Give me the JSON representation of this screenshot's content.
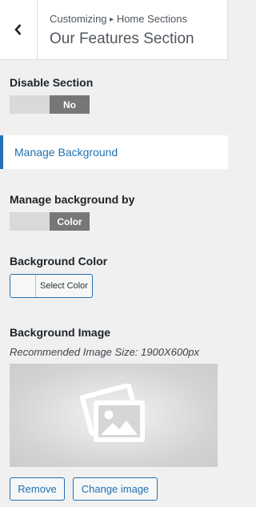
{
  "header": {
    "breadcrumb_root": "Customizing",
    "breadcrumb_sep": "▸",
    "breadcrumb_section": "Home Sections",
    "title": "Our Features Section"
  },
  "disable_section": {
    "label": "Disable Section",
    "value": "No"
  },
  "manage_background_link": "Manage Background",
  "manage_background_by": {
    "label": "Manage background by",
    "value": "Color"
  },
  "background_color": {
    "label": "Background Color",
    "button": "Select Color"
  },
  "background_image": {
    "label": "Background Image",
    "hint": "Recommended Image Size: 1900X600px",
    "remove_label": "Remove",
    "change_label": "Change image"
  },
  "colors": {
    "accent": "#2271b1",
    "toggle_on": "#777777",
    "toggle_off": "#d9d9d9"
  }
}
